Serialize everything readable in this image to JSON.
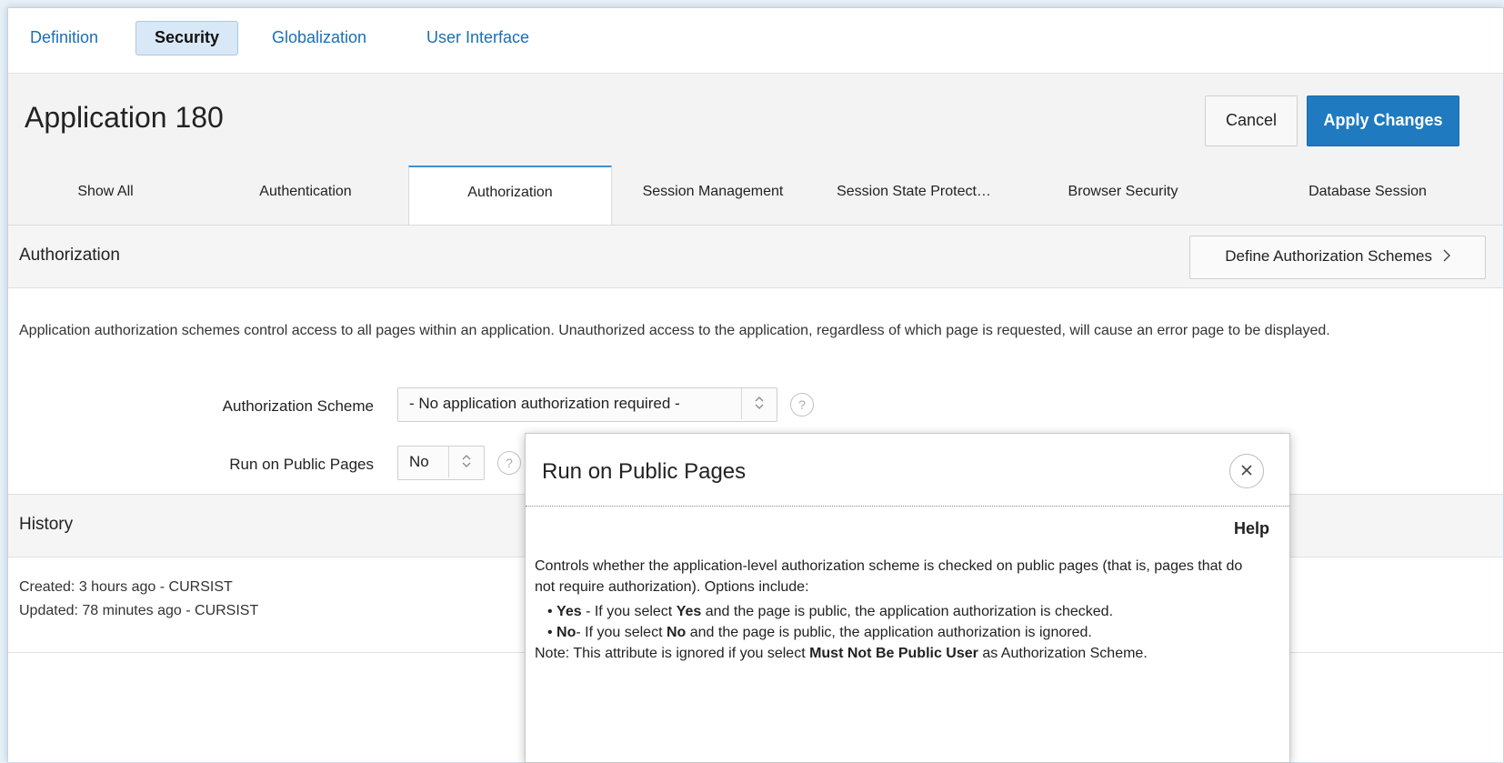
{
  "top_tabs": [
    "Definition",
    "Security",
    "Globalization",
    "User Interface"
  ],
  "page_title": "Application 180",
  "buttons": {
    "cancel": "Cancel",
    "apply": "Apply Changes"
  },
  "sub_tabs": [
    "Show All",
    "Authentication",
    "Authorization",
    "Session Management",
    "Session State Protect…",
    "Browser Security",
    "Database Session"
  ],
  "authorization": {
    "region_title": "Authorization",
    "define_button": "Define Authorization Schemes",
    "description": "Application authorization schemes control access to all pages within an application. Unauthorized access to the application, regardless of which page is requested, will cause an error page to be displayed.",
    "scheme_label": "Authorization Scheme",
    "scheme_value": "- No application authorization required -",
    "public_label": "Run on Public Pages",
    "public_value": "No"
  },
  "history": {
    "region_title": "History",
    "created": "Created: 3 hours ago - CURSIST",
    "updated": "Updated: 78 minutes ago - CURSIST"
  },
  "help_popup": {
    "title": "Run on Public Pages",
    "help_label": "Help",
    "intro": "Controls whether the application-level authorization scheme is checked on public pages (that is, pages that do not require authorization). Options include:",
    "yes_bold": "Yes",
    "yes_text_1": " - If you select ",
    "yes_bold_2": "Yes",
    "yes_text_2": " and the page is public, the application authorization is checked.",
    "no_bold": "No",
    "no_text_1": "- If you select ",
    "no_bold_2": "No",
    "no_text_2": " and the page is public, the application authorization is ignored.",
    "note_1": "Note: This attribute is ignored if you select ",
    "note_bold": "Must Not Be Public User",
    "note_2": " as Authorization Scheme."
  },
  "icons": {
    "stepper": "chevron-updown-icon",
    "help": "question-icon",
    "close": "close-icon",
    "chevron": "chevron-right-icon"
  },
  "colors": {
    "accent": "#1f7ac0",
    "link": "#1a6fb8"
  }
}
